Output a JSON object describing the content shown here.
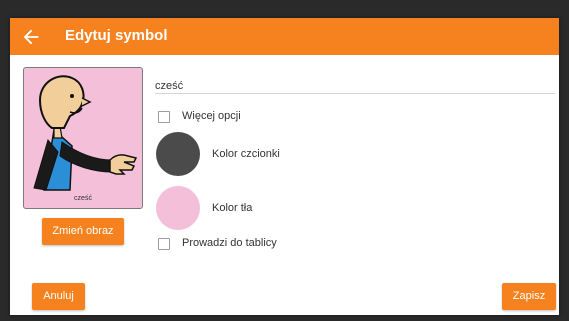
{
  "header": {
    "title": "Edytuj symbol",
    "back_icon": "arrow-left-icon",
    "bar_color": "#f5821f"
  },
  "symbol": {
    "caption": "cześć",
    "background_color": "#f4bfd9",
    "change_image_label": "Zmień obraz"
  },
  "form": {
    "name_value": "cześć",
    "more_options_label": "Więcej opcji",
    "more_options_checked": false,
    "font_color_label": "Kolor czcionki",
    "font_color": "#4b4b4b",
    "background_color_label": "Kolor tła",
    "background_color": "#f4bfd9",
    "leads_to_board_label": "Prowadzi do tablicy",
    "leads_to_board_checked": false
  },
  "actions": {
    "cancel_label": "Anuluj",
    "save_label": "Zapisz"
  }
}
